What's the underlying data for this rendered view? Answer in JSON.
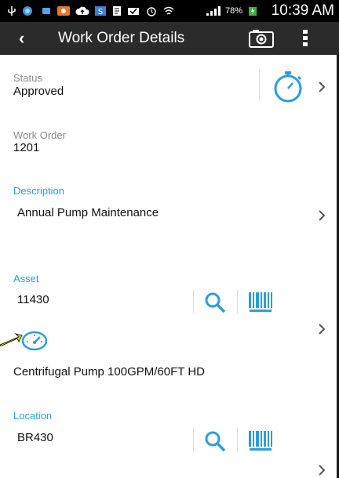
{
  "status_bar": {
    "battery_percent": "78%",
    "time": "10:39 AM"
  },
  "action_bar": {
    "title": "Work Order Details"
  },
  "status": {
    "label": "Status",
    "value": "Approved"
  },
  "work_order": {
    "label": "Work Order",
    "value": "1201"
  },
  "description": {
    "label": "Description",
    "value": "Annual Pump Maintenance"
  },
  "asset": {
    "label": "Asset",
    "value": "11430",
    "name": "Centrifugal Pump 100GPM/60FT HD"
  },
  "location": {
    "label": "Location",
    "value": "BR430"
  },
  "colors": {
    "accent": "#2a9fd6",
    "actionbar": "#2b2b2b",
    "statusbar": "#000000"
  }
}
